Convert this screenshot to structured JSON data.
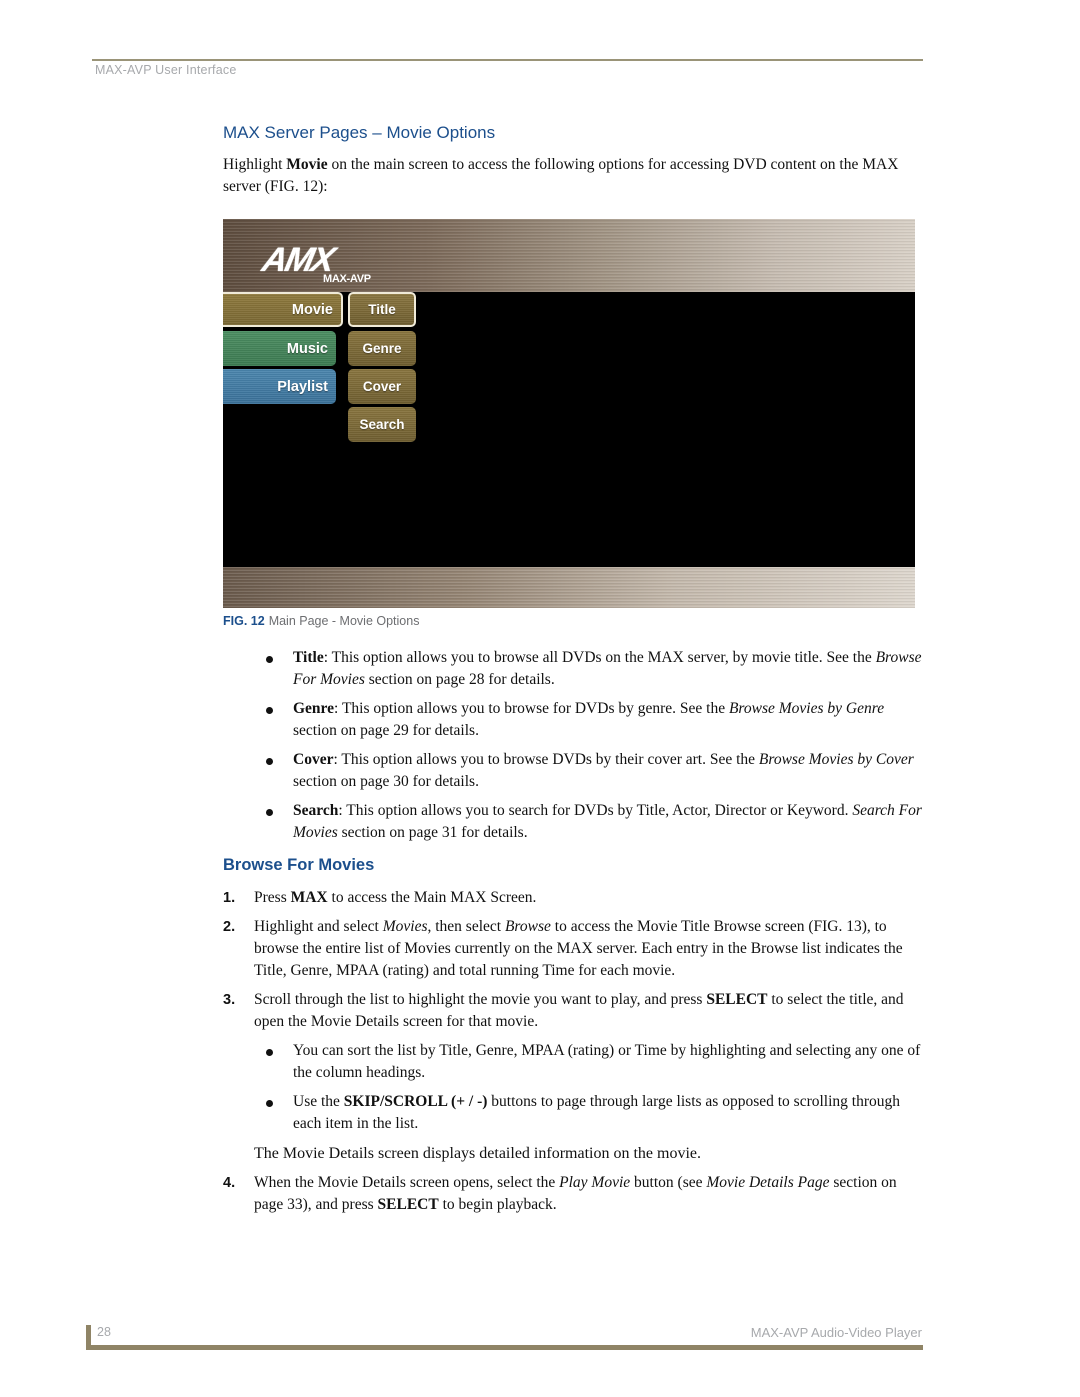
{
  "header": {
    "running_head": "MAX-AVP User Interface"
  },
  "section1": {
    "heading": "MAX Server Pages – Movie Options",
    "intro": {
      "pre": "Highlight ",
      "bold": "Movie",
      "post": " on the main screen to access the following options for accessing DVD content on the MAX server (FIG. 12):"
    }
  },
  "figure": {
    "logo_text": "AMX",
    "logo_sub": "MAX-AVP",
    "main_menu": [
      {
        "label": "Movie",
        "color": "#7f6c37",
        "selected": true
      },
      {
        "label": "Music",
        "color": "#468659",
        "selected": false
      },
      {
        "label": "Playlist",
        "color": "#437ca4",
        "selected": false
      }
    ],
    "sub_menu": [
      {
        "label": "Title",
        "selected": true
      },
      {
        "label": "Genre",
        "selected": false
      },
      {
        "label": "Cover",
        "selected": false
      },
      {
        "label": "Search",
        "selected": false
      }
    ],
    "caption_label": "FIG. 12",
    "caption_text": "Main Page - Movie Options"
  },
  "options": [
    {
      "term": "Title",
      "pre": ": This option allows you to browse all DVDs on the MAX server, by movie title. See the ",
      "ref": "Browse For Movies",
      "post": " section on page 28 for details."
    },
    {
      "term": "Genre",
      "pre": ": This option allows you to browse for DVDs by genre. See the ",
      "ref": "Browse Movies by Genre",
      "post": " section on page 29 for details."
    },
    {
      "term": "Cover",
      "pre": ": This option allows you to browse DVDs by their cover art. See the ",
      "ref": "Browse Movies by Cover",
      "post": " section on page 30 for details."
    },
    {
      "term": "Search",
      "pre": ": This option allows you to search for DVDs by Title, Actor, Director or Keyword. ",
      "ref": "Search For Movies",
      "post": " section on page 31 for details."
    }
  ],
  "section2": {
    "heading": "Browse For Movies",
    "steps": [
      {
        "num": "1.",
        "parts": {
          "a": "Press ",
          "b": "MAX",
          "c": " to access the Main MAX Screen."
        }
      },
      {
        "num": "2.",
        "parts": {
          "a": "Highlight and select ",
          "i1": "Movies",
          "b": ", then select ",
          "i2": "Browse",
          "c": " to access the Movie Title Browse screen (FIG. 13), to browse the entire list of Movies currently on the MAX server. Each entry in the Browse list indicates the Title, Genre, MPAA (rating) and total running Time for each movie."
        }
      },
      {
        "num": "3.",
        "parts": {
          "a": "Scroll through the list to highlight the movie you want to play, and press ",
          "b": "SELECT",
          "c": " to select the title, and open the Movie Details screen for that movie."
        }
      },
      {
        "num": "4.",
        "parts": {
          "a": "When the Movie Details screen opens, select the ",
          "i1": "Play Movie",
          "b": " button (see ",
          "i2": "Movie Details Page",
          "c": " section on page 33), and press ",
          "d": "SELECT",
          "e": " to begin playback."
        }
      }
    ],
    "sub_bullets": [
      {
        "text": "You can sort the list by Title, Genre, MPAA (rating) or Time by highlighting and selecting any one of the column headings."
      },
      {
        "pre": "Use the ",
        "bold": "SKIP/SCROLL (+ / -)",
        "post": " buttons to page through large lists as opposed to scrolling through each item in the list."
      }
    ],
    "note": "The Movie Details screen displays detailed information on the movie."
  },
  "footer": {
    "page_number": "28",
    "doc_title": "MAX-AVP Audio-Video Player"
  }
}
